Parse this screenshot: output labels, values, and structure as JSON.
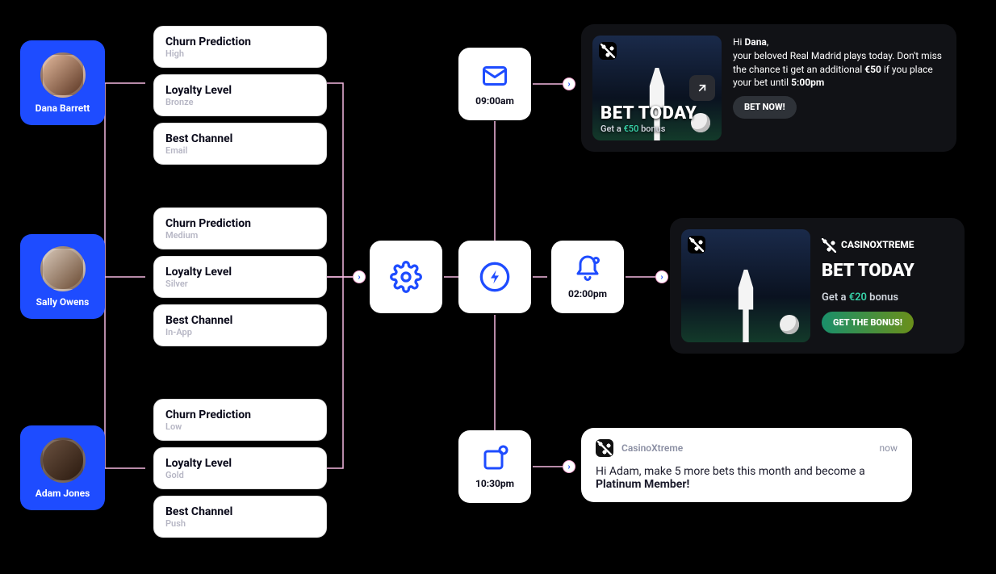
{
  "users": [
    {
      "name": "Dana Barrett",
      "avatar_css": "linear-gradient(135deg,#e1b89c,#5a3522)",
      "attrs": [
        {
          "title": "Churn Prediction",
          "value": "High"
        },
        {
          "title": "Loyalty Level",
          "value": "Bronze"
        },
        {
          "title": "Best Channel",
          "value": "Email"
        }
      ]
    },
    {
      "name": "Sally Owens",
      "avatar_css": "linear-gradient(135deg,#d7c7b8,#6a4a32)",
      "attrs": [
        {
          "title": "Churn Prediction",
          "value": "Medium"
        },
        {
          "title": "Loyalty Level",
          "value": "Silver"
        },
        {
          "title": "Best Channel",
          "value": "In-App"
        }
      ]
    },
    {
      "name": "Adam Jones",
      "avatar_css": "linear-gradient(135deg,#6a5140,#2a190e)",
      "attrs": [
        {
          "title": "Churn Prediction",
          "value": "Low"
        },
        {
          "title": "Loyalty Level",
          "value": "Gold"
        },
        {
          "title": "Best Channel",
          "value": "Push"
        }
      ]
    }
  ],
  "pipeline": {
    "email_time": "09:00am",
    "bell_time": "02:00pm",
    "push_time": "10:30pm"
  },
  "promo_email": {
    "greeting_prefix": "Hi ",
    "greeting_name": "Dana",
    "greeting_suffix": ",",
    "body_1": "your beloved Real Madrid plays today. Don't miss the chance ti get an additional ",
    "amount": "€50",
    "body_2": " if you place your bet until ",
    "deadline": "5:00pm",
    "headline": "BET TODAY",
    "subhead_prefix": "Get a ",
    "subhead_amount": "€50",
    "subhead_suffix": " bonus",
    "cta": "BET NOW!"
  },
  "promo_inapp": {
    "brand": "CASINOXTREME",
    "headline": "BET TODAY",
    "subhead_prefix": "Get a ",
    "subhead_amount": "€20",
    "subhead_suffix": " bonus",
    "cta": "GET THE BONUS!"
  },
  "push": {
    "from": "CasinoXtreme",
    "when": "now",
    "text_prefix": "Hi Adam, make 5 more bets this month and become a ",
    "text_bold": "Platinum Member!",
    "text_suffix": ""
  }
}
